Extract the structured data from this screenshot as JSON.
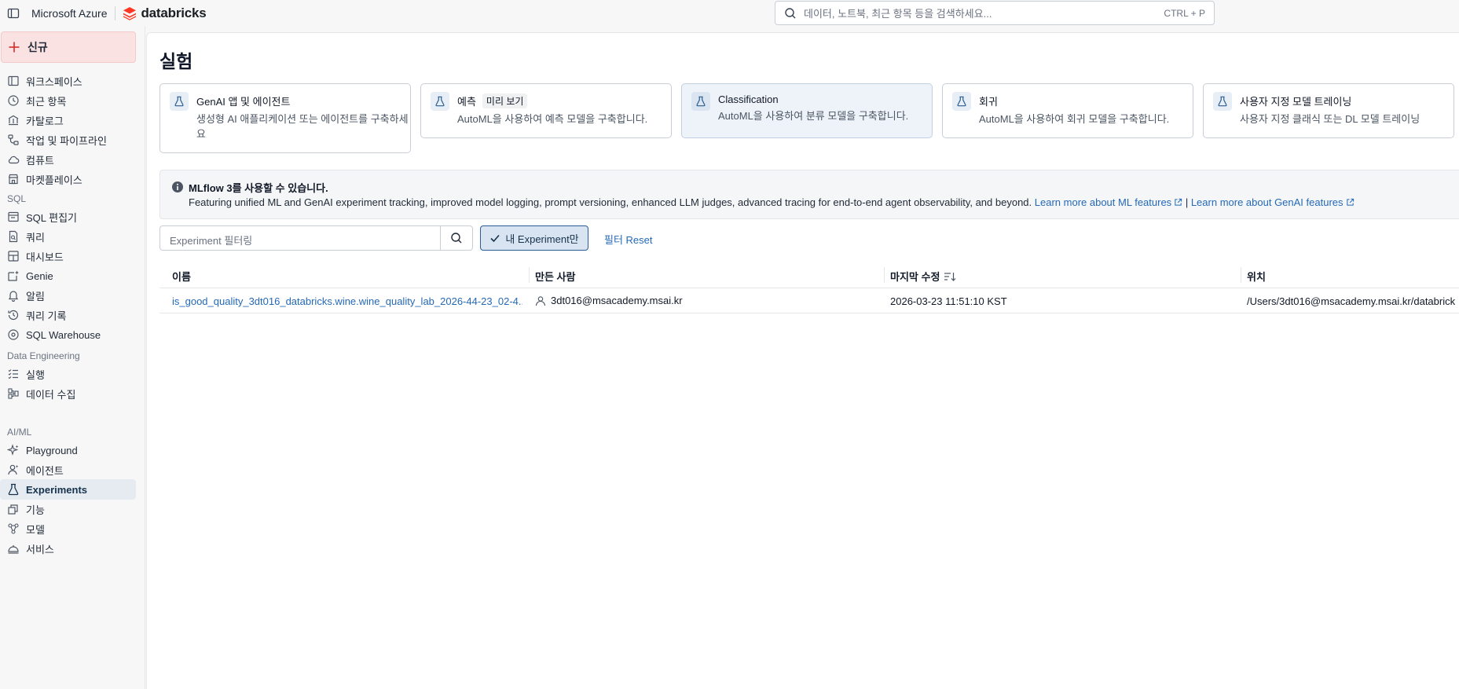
{
  "topbar": {
    "brand_microsoft": "Microsoft Azure",
    "brand_databricks": "databricks",
    "search_placeholder": "데이터, 노트북, 최근 항목 등을 검색하세요...",
    "search_shortcut": "CTRL + P"
  },
  "sidebar": {
    "new_label": "신규",
    "workspace_items": [
      {
        "label": "워크스페이스",
        "icon": "workspace-icon"
      },
      {
        "label": "최근 항목",
        "icon": "clock-icon"
      },
      {
        "label": "카탈로그",
        "icon": "catalog-icon"
      },
      {
        "label": "작업 및 파이프라인",
        "icon": "workflow-icon"
      },
      {
        "label": "컴퓨트",
        "icon": "cloud-icon"
      },
      {
        "label": "마켓플레이스",
        "icon": "store-icon"
      }
    ],
    "sql_section": "SQL",
    "sql_items": [
      {
        "label": "SQL 편집기",
        "icon": "sql-editor-icon"
      },
      {
        "label": "쿼리",
        "icon": "query-icon"
      },
      {
        "label": "대시보드",
        "icon": "dashboard-icon"
      },
      {
        "label": "Genie",
        "icon": "genie-icon"
      },
      {
        "label": "알림",
        "icon": "bell-icon"
      },
      {
        "label": "쿼리 기록",
        "icon": "history-icon"
      },
      {
        "label": "SQL Warehouse",
        "icon": "warehouse-icon"
      }
    ],
    "de_section": "Data Engineering",
    "de_items": [
      {
        "label": "실행",
        "icon": "runs-icon"
      },
      {
        "label": "데이터 수집",
        "icon": "ingest-icon"
      }
    ],
    "ml_section": "AI/ML",
    "ml_items": [
      {
        "label": "Playground",
        "icon": "sparkle-icon"
      },
      {
        "label": "에이전트",
        "icon": "agent-icon"
      },
      {
        "label": "Experiments",
        "icon": "flask-icon",
        "active": true
      },
      {
        "label": "기능",
        "icon": "features-icon"
      },
      {
        "label": "모델",
        "icon": "models-icon"
      },
      {
        "label": "서비스",
        "icon": "serving-icon"
      }
    ]
  },
  "main": {
    "title": "실험",
    "cards": [
      {
        "title": "GenAI 앱 및 에이전트",
        "desc": "생성형 AI 애플리케이션 또는 에이전트를 구축하세요"
      },
      {
        "title": "예측",
        "tag": "미리 보기",
        "desc": "AutoML을 사용하여 예측 모델을 구축합니다."
      },
      {
        "title": "Classification",
        "desc": "AutoML을 사용하여 분류 모델을 구축합니다."
      },
      {
        "title": "회귀",
        "desc": "AutoML을 사용하여 회귀 모델을 구축합니다."
      },
      {
        "title": "사용자 지정 모델 트레이닝",
        "desc": "사용자 지정 클래식 또는 DL 모델 트레이닝"
      }
    ],
    "banner": {
      "title": "MLflow 3를 사용할 수 있습니다.",
      "body": "Featuring unified ML and GenAI experiment tracking, improved model logging, prompt versioning, enhanced LLM judges, advanced tracing for end-to-end agent observability, and beyond.",
      "link_ml": "Learn more about ML features",
      "separator": "|",
      "link_genai": "Learn more about GenAI features"
    },
    "filter_placeholder": "Experiment 필터링",
    "mine_button": "내 Experiment만",
    "reset_link": "필터 Reset",
    "table": {
      "headers": [
        "이름",
        "만든 사람",
        "마지막 수정",
        "위치"
      ],
      "rows": [
        {
          "name": "is_good_quality_3dt016_databricks.wine.wine_quality_lab_2026-44-23_02-4...",
          "creator": "3dt016@msacademy.msai.kr",
          "modified": "2026-03-23 11:51:10 KST",
          "location": "/Users/3dt016@msacademy.msai.kr/databrick"
        }
      ]
    }
  }
}
